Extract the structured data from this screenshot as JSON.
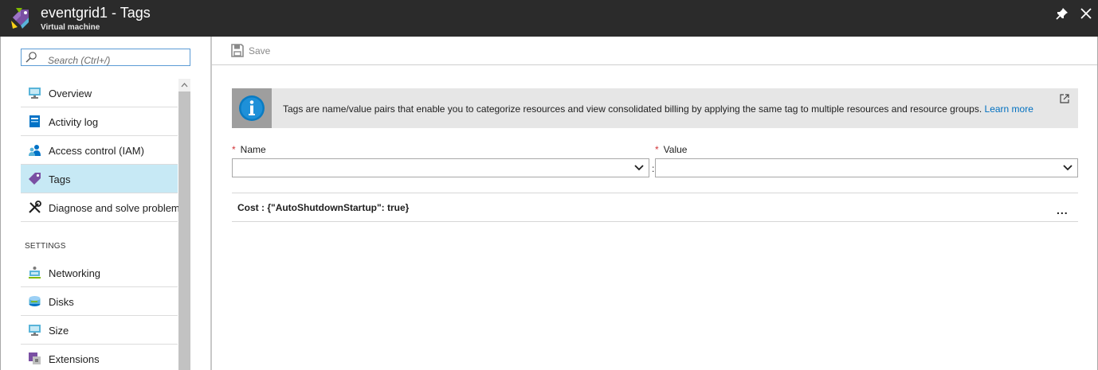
{
  "header": {
    "title": "eventgrid1 - Tags",
    "subtitle": "Virtual machine"
  },
  "sidebar": {
    "search_placeholder": "Search (Ctrl+/)",
    "items": [
      {
        "label": "Overview",
        "icon": "monitor-icon"
      },
      {
        "label": "Activity log",
        "icon": "activity-log-icon"
      },
      {
        "label": "Access control (IAM)",
        "icon": "people-icon"
      },
      {
        "label": "Tags",
        "icon": "tag-icon",
        "selected": true
      },
      {
        "label": "Diagnose and solve problems",
        "icon": "tools-icon"
      }
    ],
    "section_label": "SETTINGS",
    "settings_items": [
      {
        "label": "Networking",
        "icon": "network-icon"
      },
      {
        "label": "Disks",
        "icon": "disk-icon"
      },
      {
        "label": "Size",
        "icon": "monitor-icon"
      },
      {
        "label": "Extensions",
        "icon": "extensions-icon"
      }
    ]
  },
  "toolbar": {
    "save_label": "Save"
  },
  "info": {
    "text": "Tags are name/value pairs that enable you to categorize resources and view consolidated billing by applying the same tag to multiple resources and resource groups.",
    "link": "Learn more"
  },
  "form": {
    "name_label": "Name",
    "value_label": "Value",
    "required_marker": "*",
    "separator": ":"
  },
  "tags": [
    {
      "text": "Cost : {\"AutoShutdownStartup\": true}",
      "more": "..."
    }
  ],
  "colors": {
    "header_bg": "#2b2b2b",
    "selected_bg": "#c7e9f5",
    "link": "#0070c0",
    "required": "#d13438"
  }
}
